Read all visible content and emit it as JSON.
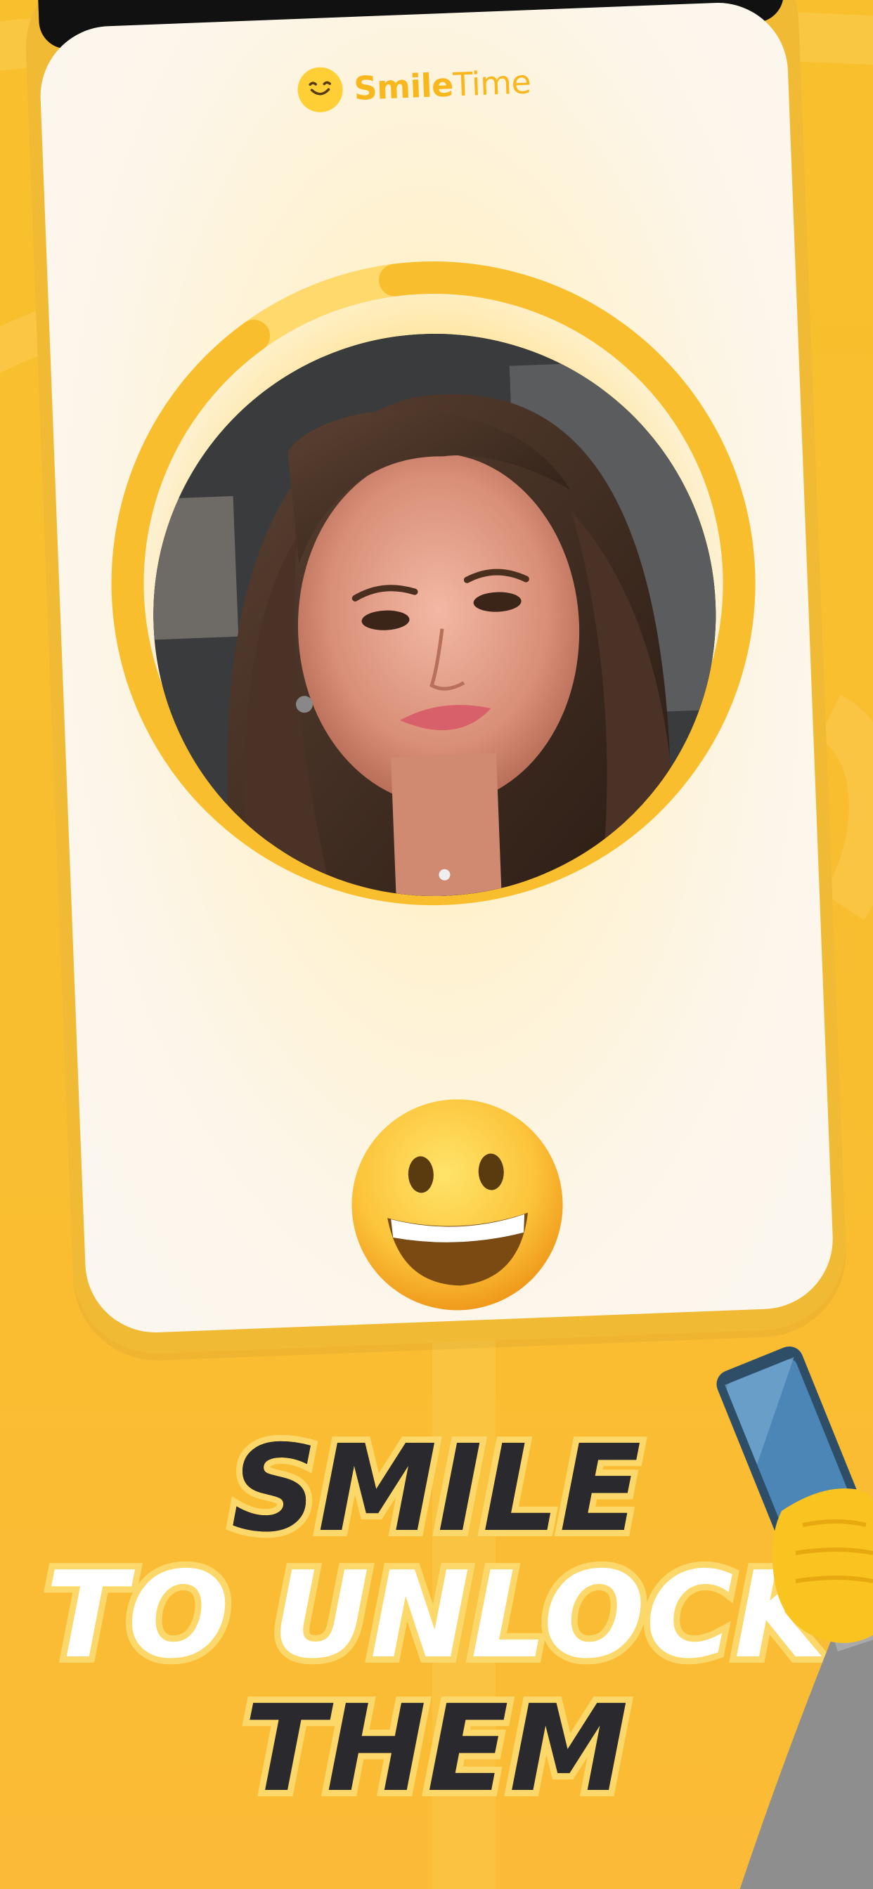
{
  "brand": {
    "name_part1": "Smile",
    "name_part2": "Time",
    "logo_icon": "smiley-logo-icon"
  },
  "screen": {
    "face_photo": "woman-selfie-photo",
    "progress_ring_fraction": 0.92,
    "reaction_emoji": "😀"
  },
  "headline": {
    "line1": "SMILE",
    "line2": "TO UNLOCK",
    "line3": "THEM"
  },
  "decor": {
    "hand_icon": "hand-holding-phone-icon"
  },
  "colors": {
    "background": "#F9BE30",
    "accent": "#FFCF35",
    "dark_text": "#2A2A2E",
    "ring": "#F8BE2D"
  }
}
